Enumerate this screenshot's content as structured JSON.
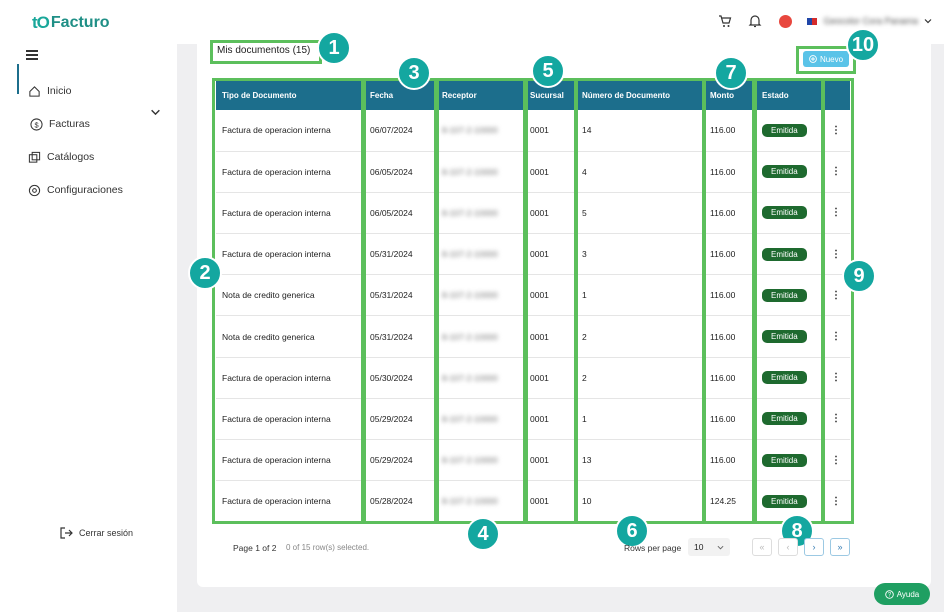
{
  "app": {
    "logo_mark": "tO",
    "logo_text": "Facturo"
  },
  "header": {
    "user_name": "Geocolor Cora Panama"
  },
  "sidebar": {
    "items": [
      {
        "label": "Inicio"
      },
      {
        "label": "Facturas"
      },
      {
        "label": "Catálogos"
      },
      {
        "label": "Configuraciones"
      }
    ],
    "logout": "Cerrar sesión"
  },
  "main": {
    "title": "Mis documentos (15)",
    "new_button": "Nuevo",
    "columns": [
      "Tipo de Documento",
      "Fecha",
      "Receptor",
      "Sucursal",
      "Número de Documento",
      "Monto",
      "Estado",
      ""
    ],
    "rows": [
      [
        "Factura de operacion interna",
        "06/07/2024",
        "8-107-2-10000",
        "0001",
        "14",
        "116.00",
        "Emitida",
        "⋮"
      ],
      [
        "Factura de operacion interna",
        "06/05/2024",
        "8-107-2-10000",
        "0001",
        "4",
        "116.00",
        "Emitida",
        "⋮"
      ],
      [
        "Factura de operacion interna",
        "06/05/2024",
        "8-107-2-10000",
        "0001",
        "5",
        "116.00",
        "Emitida",
        "⋮"
      ],
      [
        "Factura de operacion interna",
        "05/31/2024",
        "8-107-2-10000",
        "0001",
        "3",
        "116.00",
        "Emitida",
        "⋮"
      ],
      [
        "Nota de credito generica",
        "05/31/2024",
        "8-107-2-10000",
        "0001",
        "1",
        "116.00",
        "Emitida",
        "⋮"
      ],
      [
        "Nota de credito generica",
        "05/31/2024",
        "8-107-2-10000",
        "0001",
        "2",
        "116.00",
        "Emitida",
        "⋮"
      ],
      [
        "Factura de operacion interna",
        "05/30/2024",
        "8-107-2-10000",
        "0001",
        "2",
        "116.00",
        "Emitida",
        "⋮"
      ],
      [
        "Factura de operacion interna",
        "05/29/2024",
        "8-107-2-10000",
        "0001",
        "1",
        "116.00",
        "Emitida",
        "⋮"
      ],
      [
        "Factura de operacion interna",
        "05/29/2024",
        "8-107-2-10000",
        "0001",
        "13",
        "116.00",
        "Emitida",
        "⋮"
      ],
      [
        "Factura de operacion interna",
        "05/28/2024",
        "8-107-2-10000",
        "0001",
        "10",
        "124.25",
        "Emitida",
        "⋮"
      ]
    ]
  },
  "pagination": {
    "page_info": "Page 1 of 2",
    "selected_info": "0 of 15 row(s) selected.",
    "rows_per_page_label": "Rows per page",
    "rows_per_page_value": "10",
    "first": "«",
    "prev": "‹",
    "next": "›",
    "last": "»"
  },
  "help_button": "Ayuda",
  "annotations": [
    "1",
    "2",
    "3",
    "4",
    "5",
    "6",
    "7",
    "8",
    "9",
    "10"
  ],
  "colors": {
    "header_bg": "#1c6e8c",
    "badge_bg": "#1e6a2f",
    "annotation_green": "#5cbf5c",
    "annotation_teal": "#14a7a0",
    "brand": "#1f8f86"
  }
}
